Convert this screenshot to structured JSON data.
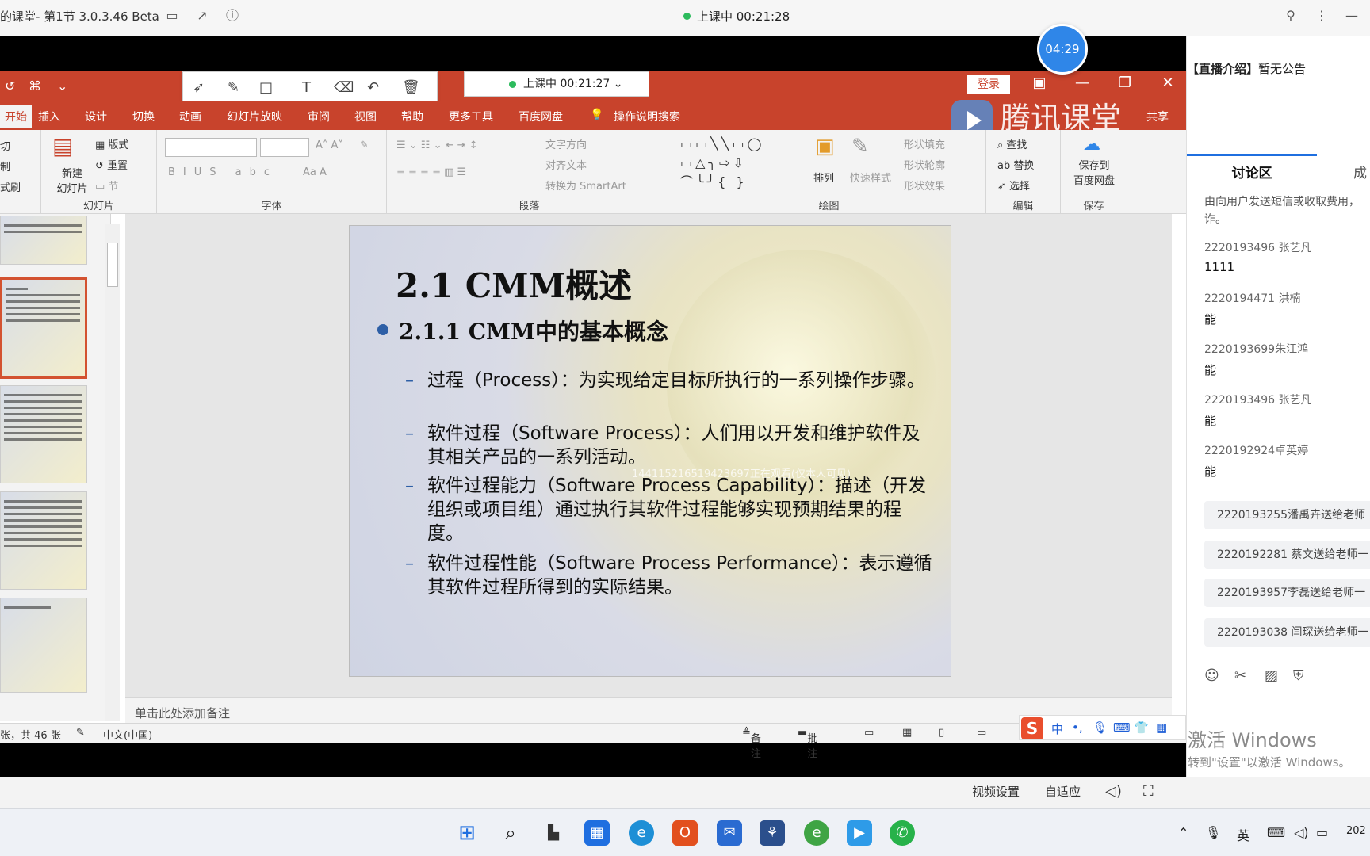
{
  "window": {
    "title": "的课堂- 第1节 3.0.3.46 Beta",
    "live_status": "上课中 00:21:28",
    "timer_badge": "04:29"
  },
  "ppt": {
    "live_pill": "上课中 00:21:27",
    "login": "登录",
    "share": "共享",
    "brand": "腾讯课堂",
    "tabs": [
      "开始",
      "插入",
      "设计",
      "切换",
      "动画",
      "幻灯片放映",
      "审阅",
      "视图",
      "帮助",
      "更多工具",
      "百度网盘",
      "操作说明搜索"
    ],
    "ribbon": {
      "clipboard_items": [
        "切",
        "制",
        "式刷"
      ],
      "slides_group": "幻灯片",
      "new_slide": "新建\n幻灯片",
      "layout": "版式",
      "reset": "重置",
      "section": "节",
      "font_group": "字体",
      "paragraph_group": "段落",
      "text_direction": "文字方向",
      "align_text": "对齐文本",
      "convert_smartart": "转换为 SmartArt",
      "drawing_group": "绘图",
      "arrange": "排列",
      "quick_styles": "快速样式",
      "shape_fill": "形状填充",
      "shape_outline": "形状轮廓",
      "shape_effects": "形状效果",
      "editing_group": "编辑",
      "find": "查找",
      "replace": "替换",
      "select": "选择",
      "save_group": "保存",
      "save_to_baidu": "保存到\n百度网盘"
    },
    "slide": {
      "title": "2.1 CMM概述",
      "subtitle": "2.1.1 CMM中的基本概念",
      "points": [
        "过程（Process）：为实现给定目标所执行的一系列操作步骤。",
        "软件过程（Software Process）：人们用以开发和维护软件及其相关产品的一系列活动。",
        "软件过程能力（Software Process Capability）：描述（开发组织或项目组）通过执行其软件过程能够实现预期结果的程度。",
        "软件过程性能（Software Process Performance）：表示遵循其软件过程所得到的实际结果。"
      ],
      "watermark": "14411521651942369​7正在观看(仅本人可见)"
    },
    "notes_placeholder": "单击此处添加备注",
    "status": {
      "slide_count": "张，共 46 张",
      "language": "中文(中国)",
      "notes": "备注",
      "comments": "批注"
    },
    "ime": [
      "中"
    ]
  },
  "right_panel": {
    "notice_label": "【直播介绍】",
    "notice_text": "暂无公告",
    "tab_active": "讨论区",
    "tab_other": "成",
    "system_msg": "由向用户发送短信或收取费用，诈。",
    "messages": [
      {
        "who": "2220193496 张艺凡",
        "text": "1111"
      },
      {
        "who": "2220194471 洪楠",
        "text": "能"
      },
      {
        "who": "2220193699朱江鸿",
        "text": "能"
      },
      {
        "who": "2220193496 张艺凡",
        "text": "能"
      },
      {
        "who": "2220192924卓英婷",
        "text": "能"
      }
    ],
    "gifts": [
      "2220193255潘禹卉送给老师",
      "2220192281 蔡文送给老师一",
      "2220193957李磊送给老师一",
      "2220193038 闫琛送给老师一"
    ]
  },
  "video_controls": {
    "settings": "视频设置",
    "adaptive": "自适应"
  },
  "activate_windows": {
    "line1": "激活 Windows",
    "line2": "转到\"设置\"以激活 Windows。"
  },
  "taskbar": {
    "ime_lang": "英",
    "clock": "202"
  }
}
